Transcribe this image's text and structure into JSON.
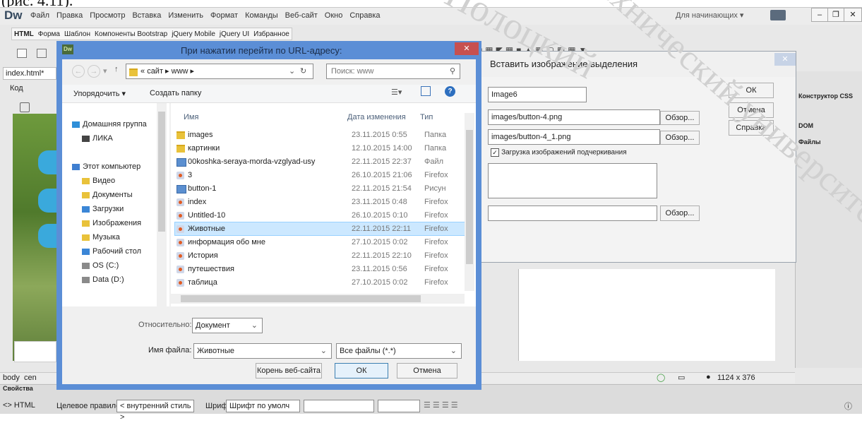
{
  "doc_caption": "(рис. 4.11).",
  "app": {
    "logo": "Dw",
    "menu": [
      "Файл",
      "Правка",
      "Просмотр",
      "Вставка",
      "Изменить",
      "Формат",
      "Команды",
      "Веб-сайт",
      "Окно",
      "Справка"
    ],
    "workspace": "Для начинающих",
    "insert_tabs": [
      "HTML",
      "Форма",
      "Шаблон",
      "Компоненты Bootstrap",
      "jQuery Mobile",
      "jQuery UI",
      "Избранное"
    ],
    "doc_tab": "index.html*",
    "code_btn": "Код",
    "panels": [
      "Конструктор CSS",
      "DOM",
      "Файлы"
    ],
    "status_tags": [
      "body",
      "cen"
    ],
    "window_size": "1124 x 376",
    "props_title": "Свойства",
    "props": {
      "html": "HTML",
      "rule_label": "Целевое правило",
      "rule_value": "< внутренний стиль >",
      "font_label": "Шрифт",
      "font_value": "Шрифт по умолч"
    }
  },
  "rollover": {
    "title": "Вставить изображение выделения",
    "image_name": "Image6",
    "original_image": "images/button-4.png",
    "rollover_image": "images/button-4_1.png",
    "preload_label": "Загрузка изображений подчеркивания",
    "browse": "Обзор...",
    "ok": "ОК",
    "cancel": "Отмена",
    "help": "Справка"
  },
  "file_dialog": {
    "title": "При нажатии перейти по URL-адресу:",
    "breadcrumb": [
      "«",
      "сайт",
      "www"
    ],
    "search_placeholder": "Поиск: www",
    "organize": "Упорядочить",
    "new_folder": "Создать папку",
    "columns": {
      "name": "Имя",
      "date": "Дата изменения",
      "type": "Тип"
    },
    "nav": [
      {
        "label": "Домашняя группа",
        "icon": "homegroup-icon"
      },
      {
        "label": "ЛИКА",
        "icon": "user-icon"
      },
      {
        "label": "",
        "icon": ""
      },
      {
        "label": "Этот компьютер",
        "icon": "computer-icon"
      },
      {
        "label": "Видео",
        "icon": "video-folder-icon"
      },
      {
        "label": "Документы",
        "icon": "documents-folder-icon"
      },
      {
        "label": "Загрузки",
        "icon": "downloads-folder-icon"
      },
      {
        "label": "Изображения",
        "icon": "pictures-folder-icon"
      },
      {
        "label": "Музыка",
        "icon": "music-folder-icon"
      },
      {
        "label": "Рабочий стол",
        "icon": "desktop-folder-icon"
      },
      {
        "label": "OS (C:)",
        "icon": "drive-icon"
      },
      {
        "label": "Data (D:)",
        "icon": "drive-icon"
      }
    ],
    "files": [
      {
        "name": "images",
        "date": "23.11.2015 0:55",
        "type": "Папка",
        "kind": "folder"
      },
      {
        "name": "картинки",
        "date": "12.10.2015 14:00",
        "type": "Папка",
        "kind": "folder"
      },
      {
        "name": "00koshka-seraya-morda-vzglyad-usy",
        "date": "22.11.2015 22:37",
        "type": "Файл",
        "kind": "image"
      },
      {
        "name": "3",
        "date": "26.10.2015 21:06",
        "type": "Firefox",
        "kind": "html"
      },
      {
        "name": "button-1",
        "date": "22.11.2015 21:54",
        "type": "Рисун",
        "kind": "image"
      },
      {
        "name": "index",
        "date": "23.11.2015 0:48",
        "type": "Firefox",
        "kind": "html"
      },
      {
        "name": "Untitled-10",
        "date": "26.10.2015 0:10",
        "type": "Firefox",
        "kind": "html"
      },
      {
        "name": "Животные",
        "date": "22.11.2015 22:11",
        "type": "Firefox",
        "kind": "html",
        "selected": true
      },
      {
        "name": "информация обо мне",
        "date": "27.10.2015 0:02",
        "type": "Firefox",
        "kind": "html"
      },
      {
        "name": "История",
        "date": "22.11.2015 22:10",
        "type": "Firefox",
        "kind": "html"
      },
      {
        "name": "путешествия",
        "date": "23.11.2015 0:56",
        "type": "Firefox",
        "kind": "html"
      },
      {
        "name": "таблица",
        "date": "27.10.2015 0:02",
        "type": "Firefox",
        "kind": "html"
      }
    ],
    "relative_label": "Относительно:",
    "relative_value": "Документ",
    "filename_label": "Имя файла:",
    "filename_value": "Животные",
    "filter_value": "Все файлы (*.*)",
    "site_root": "Корень веб-сайта",
    "ok": "ОК",
    "cancel": "Отмена"
  },
  "watermark": [
    "Полоцкий",
    "технический университет"
  ]
}
